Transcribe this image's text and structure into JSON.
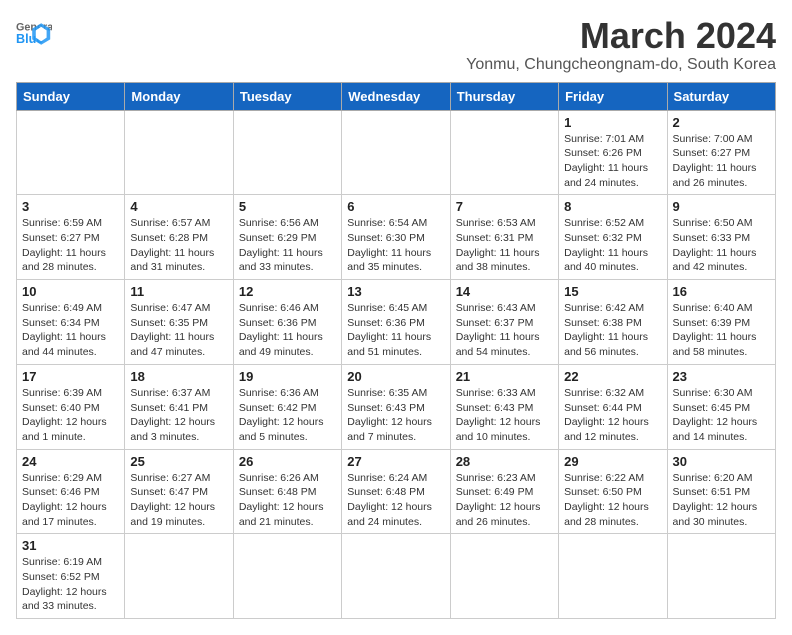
{
  "header": {
    "logo_general": "General",
    "logo_blue": "Blue",
    "title": "March 2024",
    "subtitle": "Yonmu, Chungcheongnam-do, South Korea"
  },
  "days_of_week": [
    "Sunday",
    "Monday",
    "Tuesday",
    "Wednesday",
    "Thursday",
    "Friday",
    "Saturday"
  ],
  "weeks": [
    {
      "days": [
        {
          "num": "",
          "info": ""
        },
        {
          "num": "",
          "info": ""
        },
        {
          "num": "",
          "info": ""
        },
        {
          "num": "",
          "info": ""
        },
        {
          "num": "",
          "info": ""
        },
        {
          "num": "1",
          "info": "Sunrise: 7:01 AM\nSunset: 6:26 PM\nDaylight: 11 hours\nand 24 minutes."
        },
        {
          "num": "2",
          "info": "Sunrise: 7:00 AM\nSunset: 6:27 PM\nDaylight: 11 hours\nand 26 minutes."
        }
      ]
    },
    {
      "days": [
        {
          "num": "3",
          "info": "Sunrise: 6:59 AM\nSunset: 6:27 PM\nDaylight: 11 hours\nand 28 minutes."
        },
        {
          "num": "4",
          "info": "Sunrise: 6:57 AM\nSunset: 6:28 PM\nDaylight: 11 hours\nand 31 minutes."
        },
        {
          "num": "5",
          "info": "Sunrise: 6:56 AM\nSunset: 6:29 PM\nDaylight: 11 hours\nand 33 minutes."
        },
        {
          "num": "6",
          "info": "Sunrise: 6:54 AM\nSunset: 6:30 PM\nDaylight: 11 hours\nand 35 minutes."
        },
        {
          "num": "7",
          "info": "Sunrise: 6:53 AM\nSunset: 6:31 PM\nDaylight: 11 hours\nand 38 minutes."
        },
        {
          "num": "8",
          "info": "Sunrise: 6:52 AM\nSunset: 6:32 PM\nDaylight: 11 hours\nand 40 minutes."
        },
        {
          "num": "9",
          "info": "Sunrise: 6:50 AM\nSunset: 6:33 PM\nDaylight: 11 hours\nand 42 minutes."
        }
      ]
    },
    {
      "days": [
        {
          "num": "10",
          "info": "Sunrise: 6:49 AM\nSunset: 6:34 PM\nDaylight: 11 hours\nand 44 minutes."
        },
        {
          "num": "11",
          "info": "Sunrise: 6:47 AM\nSunset: 6:35 PM\nDaylight: 11 hours\nand 47 minutes."
        },
        {
          "num": "12",
          "info": "Sunrise: 6:46 AM\nSunset: 6:36 PM\nDaylight: 11 hours\nand 49 minutes."
        },
        {
          "num": "13",
          "info": "Sunrise: 6:45 AM\nSunset: 6:36 PM\nDaylight: 11 hours\nand 51 minutes."
        },
        {
          "num": "14",
          "info": "Sunrise: 6:43 AM\nSunset: 6:37 PM\nDaylight: 11 hours\nand 54 minutes."
        },
        {
          "num": "15",
          "info": "Sunrise: 6:42 AM\nSunset: 6:38 PM\nDaylight: 11 hours\nand 56 minutes."
        },
        {
          "num": "16",
          "info": "Sunrise: 6:40 AM\nSunset: 6:39 PM\nDaylight: 11 hours\nand 58 minutes."
        }
      ]
    },
    {
      "days": [
        {
          "num": "17",
          "info": "Sunrise: 6:39 AM\nSunset: 6:40 PM\nDaylight: 12 hours\nand 1 minute."
        },
        {
          "num": "18",
          "info": "Sunrise: 6:37 AM\nSunset: 6:41 PM\nDaylight: 12 hours\nand 3 minutes."
        },
        {
          "num": "19",
          "info": "Sunrise: 6:36 AM\nSunset: 6:42 PM\nDaylight: 12 hours\nand 5 minutes."
        },
        {
          "num": "20",
          "info": "Sunrise: 6:35 AM\nSunset: 6:43 PM\nDaylight: 12 hours\nand 7 minutes."
        },
        {
          "num": "21",
          "info": "Sunrise: 6:33 AM\nSunset: 6:43 PM\nDaylight: 12 hours\nand 10 minutes."
        },
        {
          "num": "22",
          "info": "Sunrise: 6:32 AM\nSunset: 6:44 PM\nDaylight: 12 hours\nand 12 minutes."
        },
        {
          "num": "23",
          "info": "Sunrise: 6:30 AM\nSunset: 6:45 PM\nDaylight: 12 hours\nand 14 minutes."
        }
      ]
    },
    {
      "days": [
        {
          "num": "24",
          "info": "Sunrise: 6:29 AM\nSunset: 6:46 PM\nDaylight: 12 hours\nand 17 minutes."
        },
        {
          "num": "25",
          "info": "Sunrise: 6:27 AM\nSunset: 6:47 PM\nDaylight: 12 hours\nand 19 minutes."
        },
        {
          "num": "26",
          "info": "Sunrise: 6:26 AM\nSunset: 6:48 PM\nDaylight: 12 hours\nand 21 minutes."
        },
        {
          "num": "27",
          "info": "Sunrise: 6:24 AM\nSunset: 6:48 PM\nDaylight: 12 hours\nand 24 minutes."
        },
        {
          "num": "28",
          "info": "Sunrise: 6:23 AM\nSunset: 6:49 PM\nDaylight: 12 hours\nand 26 minutes."
        },
        {
          "num": "29",
          "info": "Sunrise: 6:22 AM\nSunset: 6:50 PM\nDaylight: 12 hours\nand 28 minutes."
        },
        {
          "num": "30",
          "info": "Sunrise: 6:20 AM\nSunset: 6:51 PM\nDaylight: 12 hours\nand 30 minutes."
        }
      ]
    },
    {
      "days": [
        {
          "num": "31",
          "info": "Sunrise: 6:19 AM\nSunset: 6:52 PM\nDaylight: 12 hours\nand 33 minutes."
        },
        {
          "num": "",
          "info": ""
        },
        {
          "num": "",
          "info": ""
        },
        {
          "num": "",
          "info": ""
        },
        {
          "num": "",
          "info": ""
        },
        {
          "num": "",
          "info": ""
        },
        {
          "num": "",
          "info": ""
        }
      ]
    }
  ]
}
